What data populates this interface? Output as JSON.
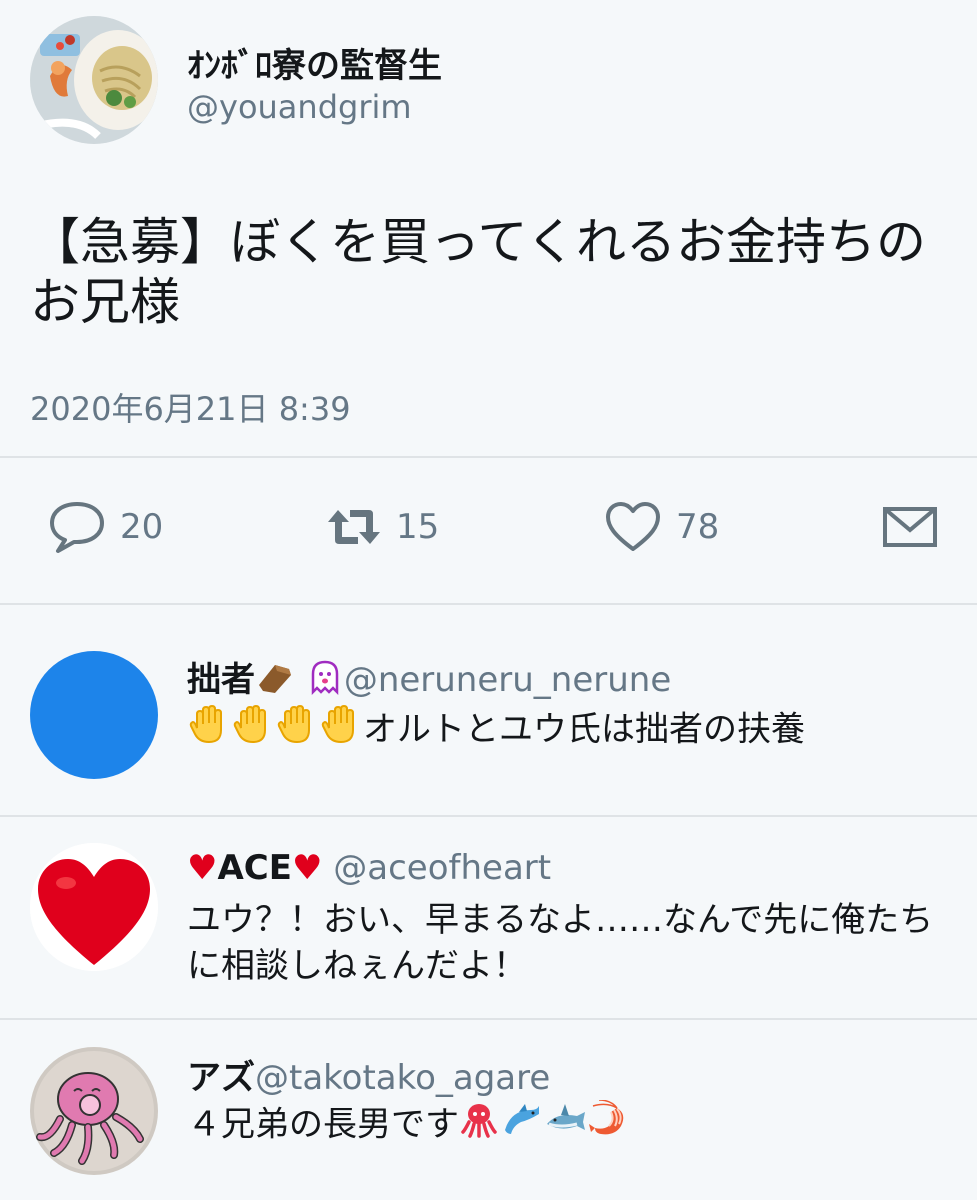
{
  "tweet": {
    "author_name": "ｵﾝﾎﾞﾛ寮の監督生",
    "author_handle": "@youandgrim",
    "text": "【急募】ぼくを買ってくれるお金持ちのお兄様",
    "timestamp": "2020年6月21日 8:39"
  },
  "actions": {
    "reply_count": "20",
    "retweet_count": "15",
    "like_count": "78"
  },
  "replies": [
    {
      "name": "拙者",
      "handle": "@neruneru_nerune",
      "text": "オルトとユウ氏は拙者の扶養",
      "avatar_color": "#1d84ea"
    },
    {
      "name_prefix": "♥",
      "name": "ACE",
      "name_suffix": "♥",
      "handle": "@aceofheart",
      "text": "ユウ？！おい、早まるなよ……なんで先に俺たちに相談しねぇんだよ！"
    },
    {
      "name": "アズ",
      "handle": "@takotako_agare",
      "text": "４兄弟の長男です"
    }
  ],
  "colors": {
    "background": "#f5f8fa",
    "icon": "#66757f",
    "divider": "#dfe3e6",
    "heart_red": "#e0001c"
  }
}
